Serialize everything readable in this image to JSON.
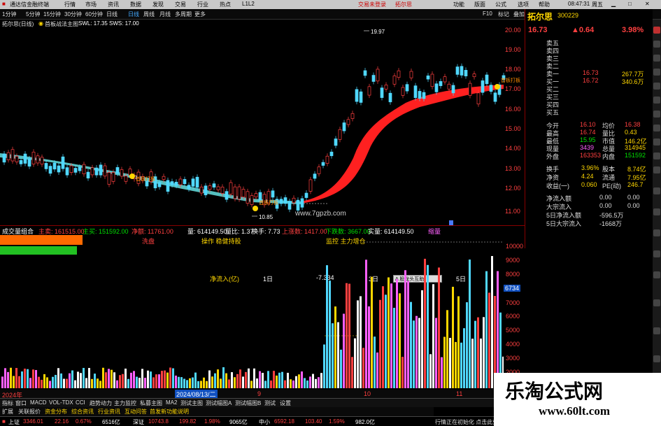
{
  "titlebar": {
    "app_title": "通达信金融终端",
    "menu": [
      "行情",
      "市场",
      "资讯",
      "数据",
      "发现",
      "交易",
      "行业",
      "热点",
      "L1L2"
    ],
    "center": "交易未登录",
    "stock_name": "拓尔思",
    "right_menu": [
      "功能",
      "版面",
      "公式",
      "选项",
      "帮助"
    ],
    "time": "08:47:31",
    "day": "周五"
  },
  "toolbar": {
    "periods": [
      "1分钟",
      "5分钟",
      "15分钟",
      "30分钟",
      "60分钟",
      "日线",
      "周线",
      "月线",
      "多周期",
      "更多"
    ],
    "right_items": [
      "F10",
      "标记",
      "叠加",
      "返回"
    ]
  },
  "chart_header": {
    "title": "拓尔思(日线)",
    "formula": "首板战法主图",
    "swl": "SWL: 17.35",
    "sws": "SWS: 17.00"
  },
  "main_chart": {
    "price_axis": [
      "20.00",
      "19.00",
      "18.00",
      "17.00",
      "16.00",
      "15.00",
      "14.00",
      "13.00",
      "12.00",
      "11.00"
    ],
    "high_label": "19.97",
    "low_label": "10.85",
    "site_watermark": "www.7gpzb.com",
    "signal_text": "首板打板",
    "signal_text2": "首板打板",
    "signal_text3": "首板打板"
  },
  "indicator_bar": {
    "name": "成交量组合",
    "items": [
      {
        "text": "主卖: 161515.00",
        "color": "#ff4040"
      },
      {
        "text": "主买: 151592.00",
        "color": "#00e000"
      },
      {
        "text": "净额: 11761.00",
        "color": "#ff4040"
      },
      {
        "text": "量: 614149.50",
        "color": "#ffffff"
      },
      {
        "text": "量比: 1.37",
        "color": "#ffffff"
      },
      {
        "text": "换手: 7.73",
        "color": "#ffffff"
      },
      {
        "text": "上涨数: 1417.00",
        "color": "#ff4040"
      },
      {
        "text": "下跌数: 3667.00",
        "color": "#00e000"
      },
      {
        "text": "实量: 614149.50",
        "color": "#ffffff"
      },
      {
        "text": "缩量",
        "color": "#ff60ff"
      }
    ]
  },
  "sub_chart": {
    "labels": {
      "l1": "洗盘",
      "l2": "操作 稳健持股",
      "l3": "监控 主力增仓",
      "net_label": "净流入(亿)",
      "d1": "1日",
      "val": "-7.334",
      "d3": "3日",
      "d5": "5日"
    },
    "axis": [
      "10000",
      "9000",
      "8000",
      "7000",
      "6000",
      "5000",
      "4000",
      "3000",
      "2000",
      "1000"
    ],
    "axis_marker": "6734",
    "tooltip": "A 股龙头互助"
  },
  "axis_bar": {
    "left": "2024年",
    "date": "2024/08/13/二",
    "m9": "9",
    "m10": "10",
    "m11": "11"
  },
  "tabs": [
    "指标",
    "窗口",
    "MACD",
    "VOL-TDX",
    "CCI",
    "趋势动力",
    "主力监控",
    "私募主图",
    "MA2",
    "测试主图",
    "测试幅图A",
    "测试幅图B",
    "测试",
    "设置"
  ],
  "tabs2": [
    "扩展",
    "关联报价",
    "资金分布",
    "综合资讯",
    "行业资讯",
    "互动问答",
    "首发新功能说明"
  ],
  "status": {
    "sh_label": "上证",
    "sh_price": "3346.01",
    "sh_chg": "22.16",
    "sh_pct": "0.67%",
    "sh_amt": "6516亿",
    "sz_label": "深证",
    "sz_price": "10743.8",
    "sz_chg": "199.82",
    "sz_pct": "1.98%",
    "sz_amt": "9065亿",
    "zx_label": "中小",
    "zx_price": "6592.18",
    "zx_chg": "103.40",
    "zx_pct": "1.59%",
    "zx_amt": "982.0亿",
    "msg": "行情正在初始化 点击此处"
  },
  "quote": {
    "name": "拓尔思",
    "code": "300229",
    "price": "16.73",
    "change": "▲0.64",
    "pct": "3.98%",
    "order_rows": [
      {
        "label": "卖五",
        "price": "",
        "vol": ""
      },
      {
        "label": "卖四",
        "price": "",
        "vol": ""
      },
      {
        "label": "卖三",
        "price": "",
        "vol": ""
      },
      {
        "label": "卖二",
        "price": "",
        "vol": ""
      },
      {
        "label": "卖一",
        "price": "16.73",
        "vol": "267.7万"
      },
      {
        "label": "买一",
        "price": "16.72",
        "vol": "340.6万"
      },
      {
        "label": "买二",
        "price": "",
        "vol": ""
      },
      {
        "label": "买三",
        "price": "",
        "vol": ""
      },
      {
        "label": "买四",
        "price": "",
        "vol": ""
      },
      {
        "label": "买五",
        "price": "",
        "vol": ""
      }
    ],
    "stats": [
      {
        "l1": "今开",
        "v1": "16.10",
        "l2": "均价",
        "v2": "16.38",
        "c1": "#ff4040",
        "c2": "#ff4040"
      },
      {
        "l1": "最高",
        "v1": "16.74",
        "l2": "量比",
        "v2": "0.43",
        "c1": "#ff4040",
        "c2": "#ffd700"
      },
      {
        "l1": "最低",
        "v1": "15.95",
        "l2": "市值",
        "v2": "146.2亿",
        "c1": "#00e000",
        "c2": "#ffd700"
      },
      {
        "l1": "现量",
        "v1": "3439",
        "l2": "总量",
        "v2": "314945",
        "c1": "#ff60ff",
        "c2": "#ffd700"
      },
      {
        "l1": "外盘",
        "v1": "163353",
        "l2": "内盘",
        "v2": "151592",
        "c1": "#ff4040",
        "c2": "#00e000"
      }
    ],
    "stats2": [
      {
        "l1": "换手",
        "v1": "3.96%",
        "l2": "股本",
        "v2": "8.74亿"
      },
      {
        "l1": "净资",
        "v1": "4.24",
        "l2": "流通",
        "v2": "7.95亿"
      },
      {
        "l1": "收益(一)",
        "v1": "0.060",
        "l2": "PE(动)",
        "v2": "246.7"
      }
    ],
    "flows": [
      {
        "label": "净流入额",
        "v1": "0.00",
        "v2": "0.00"
      },
      {
        "label": "大宗流入",
        "v1": "0.00",
        "v2": "0.00"
      },
      {
        "label": "5日净流入额",
        "v1": "-596.5万",
        "v2": ""
      },
      {
        "label": "5日大宗流入",
        "v1": "-1668万",
        "v2": ""
      }
    ]
  },
  "watermark": {
    "cn": "乐淘公式网",
    "url": "www.60lt.com"
  }
}
